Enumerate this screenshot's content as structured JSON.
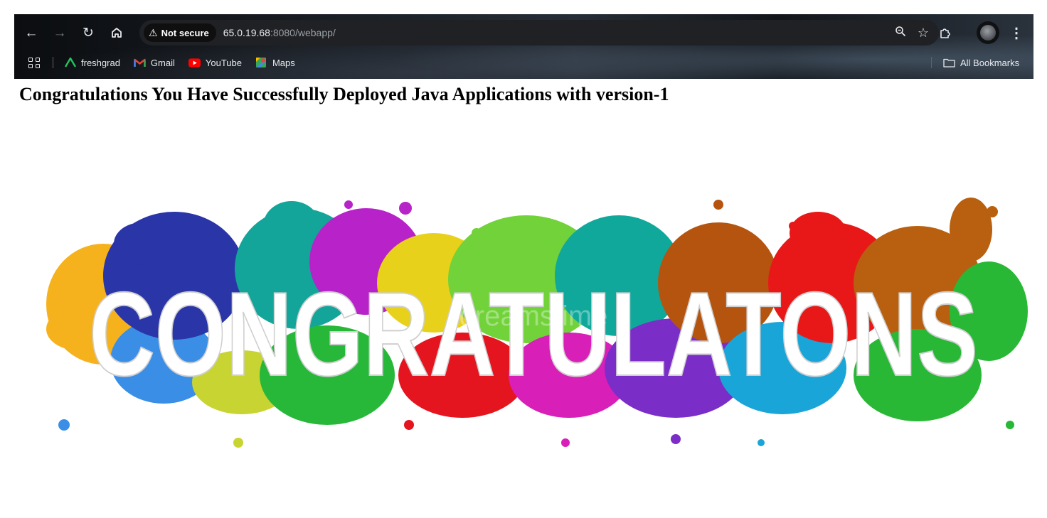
{
  "browser": {
    "security_label": "Not secure",
    "url_host": "65.0.19.68",
    "url_rest": ":8080/webapp/",
    "icons": [
      "back-arrow-icon",
      "forward-arrow-icon",
      "reload-icon",
      "home-icon",
      "warning-icon",
      "zoom-icon",
      "star-icon",
      "extensions-icon",
      "avatar",
      "more-vert-icon"
    ]
  },
  "bookmarks": {
    "items": [
      {
        "label": "freshgrad",
        "icon": "freshgrad-icon",
        "color": "#22c55e"
      },
      {
        "label": "Gmail",
        "icon": "gmail-icon",
        "color": "#ea4335"
      },
      {
        "label": "YouTube",
        "icon": "youtube-icon",
        "color": "#ff0000"
      },
      {
        "label": "Maps",
        "icon": "maps-icon",
        "color": "#34a853"
      }
    ],
    "all_bookmarks_label": "All Bookmarks"
  },
  "page": {
    "heading": "Congratulations You Have Successfully Deployed Java Applications with version-1",
    "banner": {
      "image_word": "CONGRATULATONS",
      "watermark": "dreamstime"
    }
  }
}
